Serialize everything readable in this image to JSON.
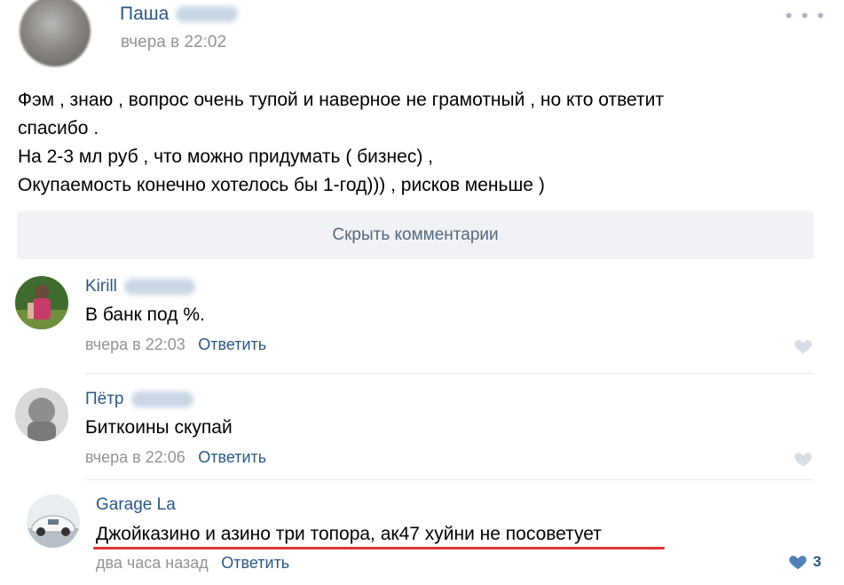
{
  "post": {
    "author": "Паша",
    "time": "вчера в 22:02",
    "menu_icon": "more-icon",
    "text_lines": [
      "Фэм , знаю , вопрос очень тупой и наверное не грамотный , но кто ответит",
      "спасибо .",
      "На 2-3 мл руб , что можно придумать ( бизнес) ,",
      "Окупаемость конечно хотелось бы 1-год))) , рисков меньше )"
    ],
    "hide_comments_label": "Скрыть комментарии"
  },
  "comments": [
    {
      "author": "Kirill",
      "text": "В банк под %.",
      "time": "вчера в 22:03",
      "reply_label": "Ответить"
    },
    {
      "author": "Пётр",
      "text": "Биткоины скупай",
      "time": "вчера в 22:06",
      "reply_label": "Ответить"
    },
    {
      "author": "Garage La",
      "text": "Джойказино и азино три топора, ак47 хуйни не посоветует",
      "time": "два часа назад",
      "reply_label": "Ответить",
      "likes": "3"
    }
  ],
  "colors": {
    "link": "#2a5885",
    "meta": "#939393",
    "button_bg": "#f0f2f5",
    "like_idle": "#d7dee6",
    "like_active": "#5181b8",
    "underline": "#e63333"
  }
}
